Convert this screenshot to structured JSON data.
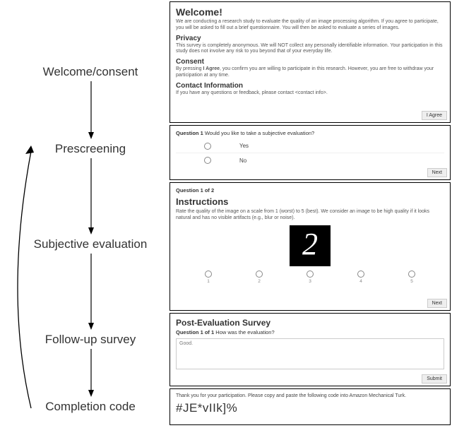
{
  "flow": {
    "labels": [
      "Welcome/consent",
      "Prescreening",
      "Subjective evaluation",
      "Follow-up survey",
      "Completion code"
    ]
  },
  "welcome": {
    "title": "Welcome!",
    "intro": "We are conducting a research study to evaluate the quality of an image processing algorithm. If you agree to participate, you will be asked to fill out a brief questionnaire. You will then be asked to evaluate a series of images.",
    "privacy_h": "Privacy",
    "privacy": "This survey is completely anonymous. We will NOT collect any personally identifiable information. Your participation in this study does not involve any risk to you beyond that of your everyday life.",
    "consent_h": "Consent",
    "consent_pre": "By pressing ",
    "consent_bold": "I Agree",
    "consent_post": ", you confirm you are willing to participate in this research. However, you are free to withdraw your participation at any time.",
    "contact_h": "Contact Information",
    "contact": "If you have any questions or feedback, please contact <contact info>.",
    "agree_btn": "I Agree"
  },
  "prescreen": {
    "q_label": "Question 1",
    "q_text": " Would you like to take a subjective evaluation?",
    "opt_yes": "Yes",
    "opt_no": "No",
    "next_btn": "Next"
  },
  "eval": {
    "counter": "Question 1 of 2",
    "instr_h": "Instructions",
    "instr": "Rate the quality of the image on a scale from 1 (worst) to 5 (best). We consider an image to be high quality if it looks natural and has no visible artifacts (e.g., blur or noise).",
    "digit": "2",
    "scale": [
      "1",
      "2",
      "3",
      "4",
      "5"
    ],
    "next_btn": "Next"
  },
  "post": {
    "title": "Post-Evaluation Survey",
    "q_label": "Question 1 of 1",
    "q_text": " How was the evaluation?",
    "value": "Good.",
    "submit_btn": "Submit"
  },
  "complete": {
    "thanks": "Thank you for your participation. Please copy and paste the following code into Amazon Mechanical Turk.",
    "code": "#JE*vIIk]%"
  }
}
